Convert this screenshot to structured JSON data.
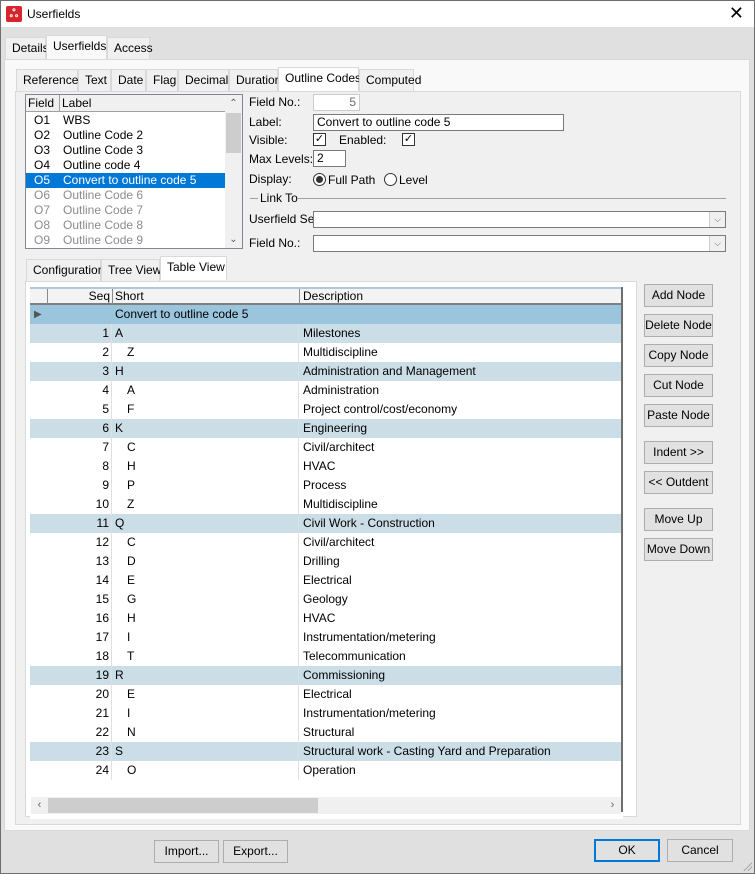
{
  "window": {
    "title": "Userfields",
    "app_icon": "app-logo-icon",
    "close_icon": "close-icon",
    "close_glyph": "✕"
  },
  "outer_tabs": [
    {
      "label": "Details",
      "active": false
    },
    {
      "label": "Userfields",
      "active": true
    },
    {
      "label": "Access",
      "active": false
    }
  ],
  "inner_tabs": [
    {
      "label": "Reference",
      "active": false
    },
    {
      "label": "Text",
      "active": false
    },
    {
      "label": "Date",
      "active": false
    },
    {
      "label": "Flag",
      "active": false
    },
    {
      "label": "Decimal",
      "active": false
    },
    {
      "label": "Duration",
      "active": false
    },
    {
      "label": "Outline Codes",
      "active": true
    },
    {
      "label": "Computed",
      "active": false
    }
  ],
  "field_list": {
    "headers": [
      "Field",
      "Label"
    ],
    "rows": [
      {
        "field": "O1",
        "label": "WBS",
        "state": "normal"
      },
      {
        "field": "O2",
        "label": "Outline Code 2",
        "state": "normal"
      },
      {
        "field": "O3",
        "label": "Outline Code 3",
        "state": "normal"
      },
      {
        "field": "O4",
        "label": "Outline code 4",
        "state": "normal"
      },
      {
        "field": "O5",
        "label": "Convert to outline code 5",
        "state": "selected"
      },
      {
        "field": "O6",
        "label": "Outline Code 6",
        "state": "disabled"
      },
      {
        "field": "O7",
        "label": "Outline Code 7",
        "state": "disabled"
      },
      {
        "field": "O8",
        "label": "Outline Code 8",
        "state": "disabled"
      },
      {
        "field": "O9",
        "label": "Outline Code 9",
        "state": "disabled"
      }
    ],
    "scroll_up_glyph": "⌃",
    "scroll_down_glyph": "⌄"
  },
  "properties": {
    "field_no_label": "Field No.:",
    "field_no_value": "5",
    "label_label": "Label:",
    "label_value": "Convert to outline code 5",
    "visible_label": "Visible:",
    "visible_checked": true,
    "enabled_label": "Enabled:",
    "enabled_checked": true,
    "check_glyph": "✓",
    "max_levels_label": "Max Levels:",
    "max_levels_value": "2",
    "display_label": "Display:",
    "display_options": [
      {
        "label": "Full Path",
        "selected": true
      },
      {
        "label": "Level",
        "selected": false
      }
    ],
    "link_to_label": "Link To",
    "userfield_set_label": "Userfield Set:",
    "userfield_set_value": "",
    "link_field_no_label": "Field No.:",
    "link_field_no_value": "",
    "dropdown_glyph": "⌵"
  },
  "sub_tabs": [
    {
      "label": "Configuration",
      "active": false
    },
    {
      "label": "Tree View",
      "active": false
    },
    {
      "label": "Table View",
      "active": true
    }
  ],
  "table": {
    "headers": {
      "seq": "Seq",
      "short": "Short",
      "description": "Description"
    },
    "root_label": "Convert to outline code 5",
    "row_indicator_glyph": "▶",
    "rows": [
      {
        "seq": "1",
        "short": "A",
        "level": 1,
        "description": "Milestones"
      },
      {
        "seq": "2",
        "short": "Z",
        "level": 2,
        "description": "Multidiscipline"
      },
      {
        "seq": "3",
        "short": "H",
        "level": 1,
        "description": "Administration and Management"
      },
      {
        "seq": "4",
        "short": "A",
        "level": 2,
        "description": "Administration"
      },
      {
        "seq": "5",
        "short": "F",
        "level": 2,
        "description": "Project control/cost/economy"
      },
      {
        "seq": "6",
        "short": "K",
        "level": 1,
        "description": "Engineering"
      },
      {
        "seq": "7",
        "short": "C",
        "level": 2,
        "description": "Civil/architect"
      },
      {
        "seq": "8",
        "short": "H",
        "level": 2,
        "description": "HVAC"
      },
      {
        "seq": "9",
        "short": "P",
        "level": 2,
        "description": "Process"
      },
      {
        "seq": "10",
        "short": "Z",
        "level": 2,
        "description": "Multidiscipline"
      },
      {
        "seq": "11",
        "short": "Q",
        "level": 1,
        "description": "Civil Work - Construction"
      },
      {
        "seq": "12",
        "short": "C",
        "level": 2,
        "description": "Civil/architect"
      },
      {
        "seq": "13",
        "short": "D",
        "level": 2,
        "description": "Drilling"
      },
      {
        "seq": "14",
        "short": "E",
        "level": 2,
        "description": "Electrical"
      },
      {
        "seq": "15",
        "short": "G",
        "level": 2,
        "description": "Geology"
      },
      {
        "seq": "16",
        "short": "H",
        "level": 2,
        "description": "HVAC"
      },
      {
        "seq": "17",
        "short": "I",
        "level": 2,
        "description": "Instrumentation/metering"
      },
      {
        "seq": "18",
        "short": "T",
        "level": 2,
        "description": "Telecommunication"
      },
      {
        "seq": "19",
        "short": "R",
        "level": 1,
        "description": "Commissioning"
      },
      {
        "seq": "20",
        "short": "E",
        "level": 2,
        "description": "Electrical"
      },
      {
        "seq": "21",
        "short": "I",
        "level": 2,
        "description": "Instrumentation/metering"
      },
      {
        "seq": "22",
        "short": "N",
        "level": 2,
        "description": "Structural"
      },
      {
        "seq": "23",
        "short": "S",
        "level": 1,
        "description": "Structural work - Casting Yard and Preparation"
      },
      {
        "seq": "24",
        "short": "O",
        "level": 2,
        "description": "Operation"
      }
    ],
    "scroll_left_glyph": "‹",
    "scroll_right_glyph": "›"
  },
  "node_buttons": [
    "Add Node",
    "Delete Node",
    "Copy Node",
    "Cut Node",
    "Paste Node",
    "Indent >>",
    "<< Outdent",
    "Move Up",
    "Move Down"
  ],
  "footer": {
    "import_label": "Import...",
    "export_label": "Export...",
    "ok_label": "OK",
    "cancel_label": "Cancel"
  },
  "colors": {
    "selection": "#0078d7",
    "group_row": "#cbdde6",
    "root_row": "#9ac5dc",
    "app_icon": "#d8242c"
  }
}
